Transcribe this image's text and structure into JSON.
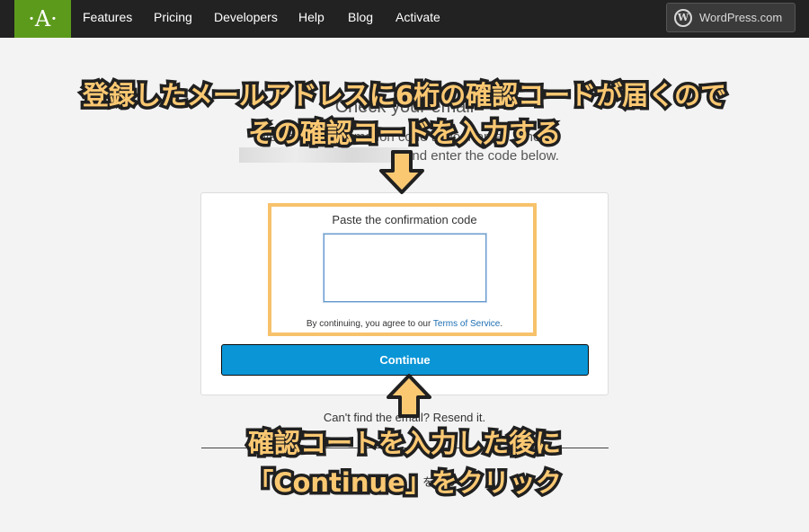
{
  "nav": {
    "logo_letter": "·A·",
    "items": [
      "Features",
      "Pricing",
      "Developers",
      "Help",
      "Blog",
      "Activate"
    ],
    "wordpress_label": "WordPress.com",
    "wordpress_icon": "wordpress-logo-icon"
  },
  "page": {
    "title": "Check your email",
    "subtitle_line1": "We sent a confirmation code to your email. Check",
    "subtitle_line2": "and enter the code below.",
    "code_label": "Paste the confirmation code",
    "code_value": "",
    "tos_prefix": "By continuing, you agree to our ",
    "tos_link": "Terms of Service",
    "tos_suffix": ".",
    "continue_label": "Continue",
    "resend_text": "Can't find the email? Resend it.",
    "bottom_link_text": "をクリック"
  },
  "annotations": {
    "top_line1": "登録したメールアドレスに6桁の確認コードが届くので",
    "top_line2": "その確認コードを入力する",
    "bottom_line1": "確認コートを入力した後に",
    "bottom_line2": "「Continue」をクリック",
    "accent_color": "#fbc872",
    "outline_color": "#202020"
  }
}
